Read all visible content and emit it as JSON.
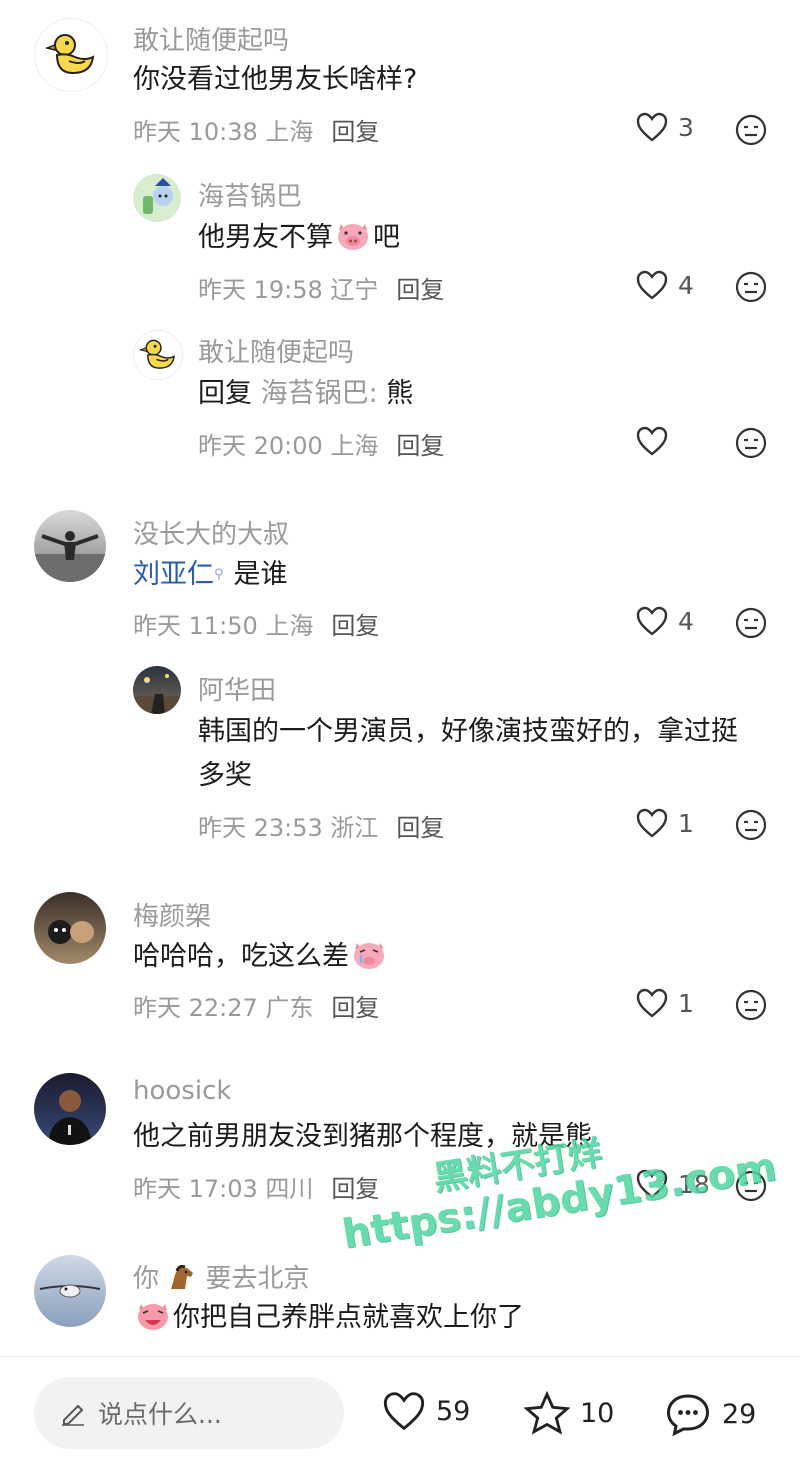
{
  "comments": [
    {
      "user": "敢让随便起吗",
      "text": "你没看过他男友长啥样?",
      "time": "昨天 10:38 上海",
      "reply": "回复",
      "likes": "3"
    },
    {
      "user": "海苔锅巴",
      "text_before": "他男友不算",
      "text_after": "吧",
      "time": "昨天 19:58 辽宁",
      "reply": "回复",
      "likes": "4"
    },
    {
      "user": "敢让随便起吗",
      "reply_prefix": "回复",
      "reply_to": "海苔锅巴:",
      "text": "熊",
      "time": "昨天 20:00 上海",
      "reply": "回复",
      "likes": ""
    },
    {
      "user": "没长大的大叔",
      "mention": "刘亚仁",
      "text": "是谁",
      "time": "昨天 11:50 上海",
      "reply": "回复",
      "likes": "4"
    },
    {
      "user": "阿华田",
      "text_line1": "韩国的一个男演员，好像演技蛮好的，拿过挺",
      "text_line2": "多奖",
      "time": "昨天 23:53 浙江",
      "reply": "回复",
      "likes": "1"
    },
    {
      "user": "梅颜槊",
      "text": "哈哈哈，吃这么差",
      "time": "昨天 22:27 广东",
      "reply": "回复",
      "likes": "1"
    },
    {
      "user": "hoosick",
      "text": "他之前男朋友没到猪那个程度，就是熊",
      "time": "昨天 17:03 四川",
      "reply": "回复",
      "likes": "18"
    },
    {
      "user_before": "你",
      "user_after": "要去北京",
      "text": "你把自己养胖点就喜欢上你了"
    }
  ],
  "watermark": {
    "line1": "黑料不打烊",
    "line2": "https://abdy13.com"
  },
  "bottom_bar": {
    "placeholder": "说点什么...",
    "likes": "59",
    "favorites": "10",
    "comments": "29"
  },
  "icons": {
    "like": "heart-outline-icon",
    "dislike": "neutral-face-icon",
    "edit": "pencil-icon",
    "favorite": "star-outline-icon",
    "comment": "chat-bubble-icon"
  }
}
